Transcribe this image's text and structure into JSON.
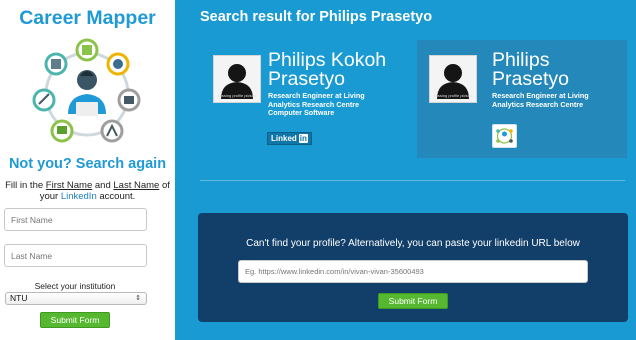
{
  "sidebar": {
    "brand": "Career Mapper",
    "heading": "Not you? Search again",
    "instructions": {
      "part1": "Fill in the ",
      "first_name": "First Name",
      "and": " and ",
      "last_name": "Last Name",
      "part2": " of your ",
      "linkedin": "LinkedIn",
      "part3": " account."
    },
    "first_name_placeholder": "First Name",
    "last_name_placeholder": "Last Name",
    "institution_label": "Select your institution",
    "institution_selected": "NTU",
    "submit_label": "Submit Form"
  },
  "main": {
    "title": "Search result for Philips Prasetyo",
    "results": [
      {
        "name": "Philips Kokoh Prasetyo",
        "avatar_text": "Missing profile picture",
        "title": "Research Engineer at Living Analytics Research Centre",
        "subtitle": "Computer Software",
        "source": "Linked",
        "source_in": "in"
      },
      {
        "name": "Philips Prasetyo",
        "avatar_text": "Missing profile picture",
        "title": "Research Engineer at Living Analytics Research Centre"
      }
    ],
    "fallback": {
      "prompt": "Can't find your profile? Alternatively, you can paste your linkedin URL below",
      "url_placeholder": "Eg. https://www.linkedin.com/in/vivan-vivan-35600493",
      "submit_label": "Submit Form"
    }
  },
  "colors": {
    "brand": "#1f9ad6",
    "main_bg": "#1a9ad2",
    "selected_card": "#2489ba",
    "panel_bg": "#123f6a",
    "button": "#55b830"
  }
}
